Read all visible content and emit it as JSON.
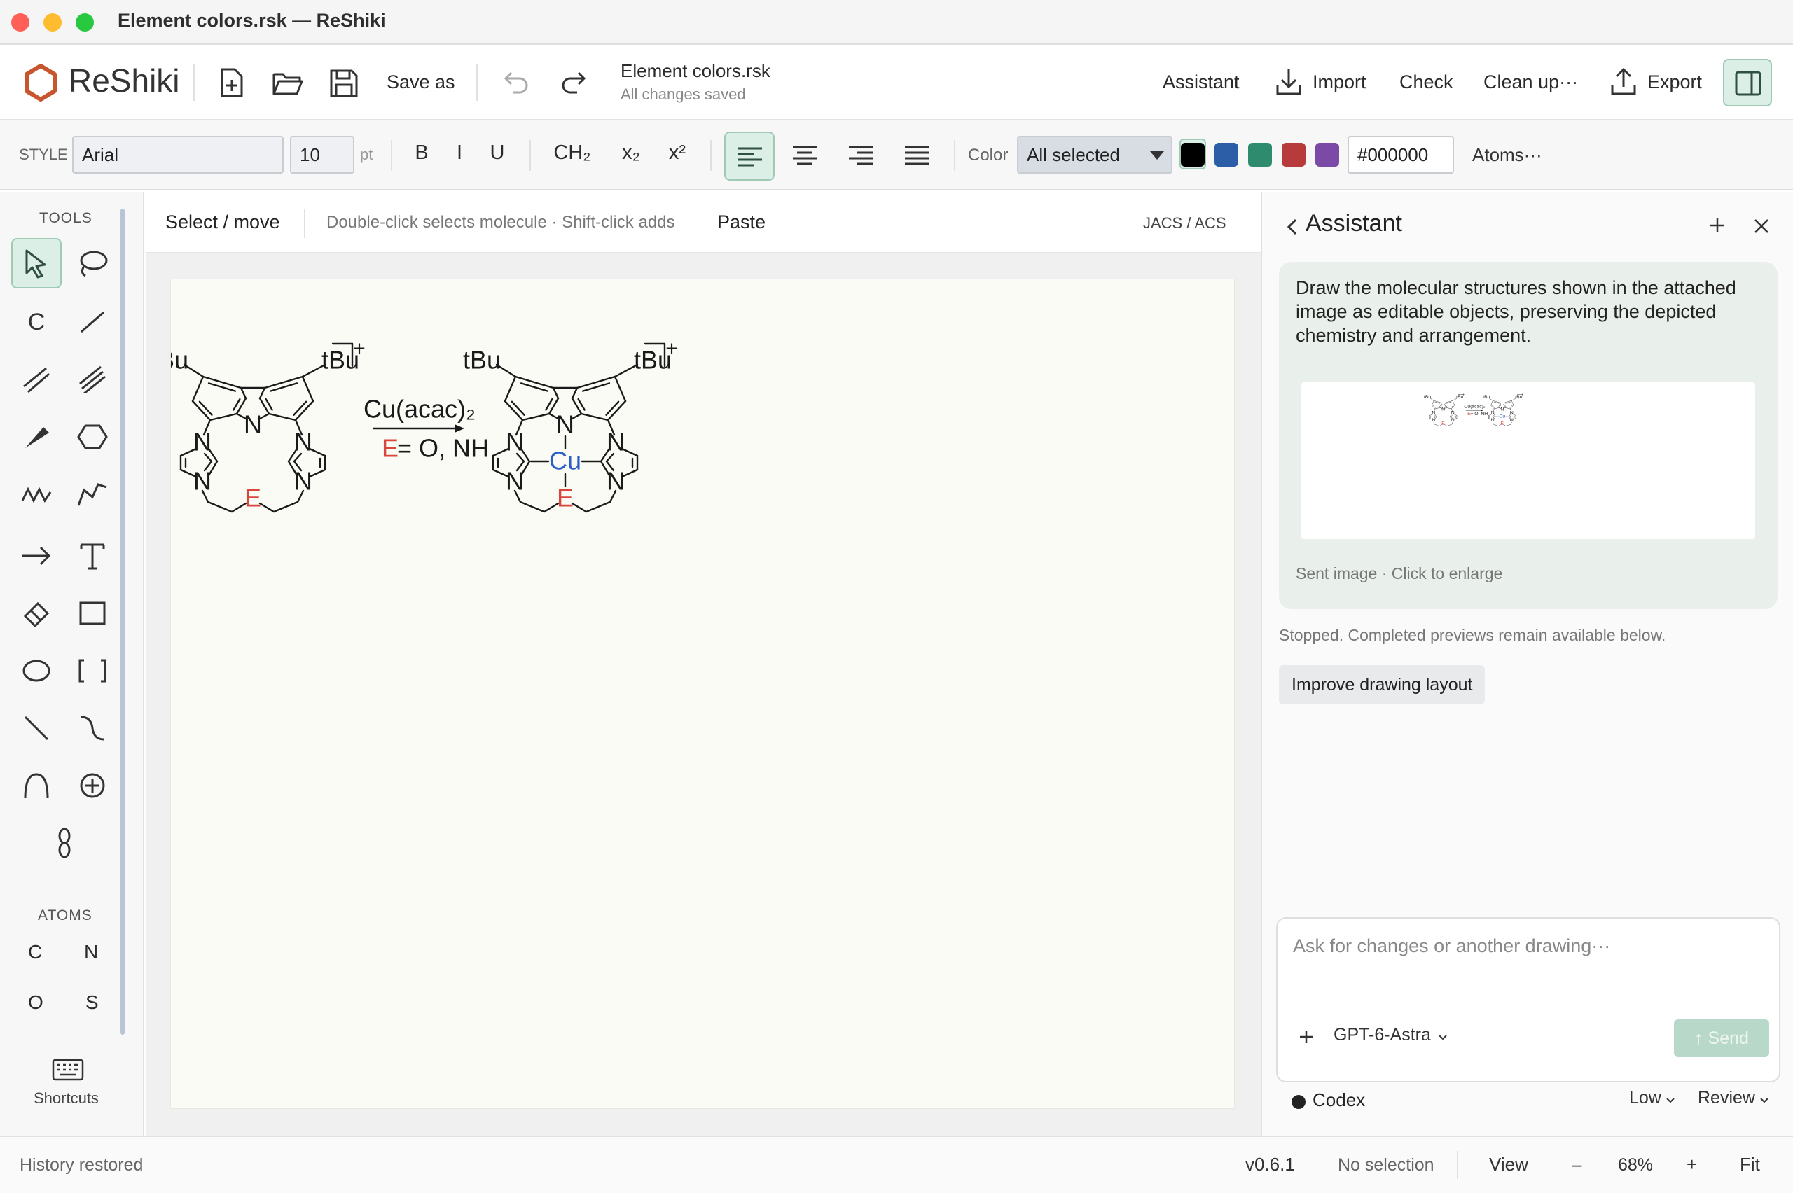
{
  "window": {
    "title": "Element colors.rsk — ReShiki"
  },
  "app": {
    "name": "ReShiki"
  },
  "toolbar": {
    "save_as": "Save as",
    "doc_name": "Element colors.rsk",
    "doc_status": "All changes saved",
    "assistant": "Assistant",
    "import": "Import",
    "check": "Check",
    "cleanup": "Clean up···",
    "export": "Export"
  },
  "style": {
    "label": "STYLE",
    "font": "Arial",
    "size": "10",
    "unit": "pt",
    "bold": "B",
    "italic": "I",
    "underline": "U",
    "ch2": "CH₂",
    "subscript": "x₂",
    "superscript": "x²",
    "color_label": "Color",
    "color_select": "All selected",
    "hex": "#000000",
    "atoms": "Atoms···",
    "swatches": [
      "#000000",
      "#2b5ea7",
      "#2e8b6e",
      "#b83b3b",
      "#7b4aa6"
    ]
  },
  "left": {
    "tools_caption": "TOOLS",
    "atoms_caption": "ATOMS",
    "atom_c": "C",
    "atom_n": "N",
    "atom_o": "O",
    "atom_s": "S",
    "chain_tool": "C",
    "shortcuts": "Shortcuts"
  },
  "mode": {
    "current": "Select / move",
    "hint": "Double-click selects molecule · Shift-click adds",
    "paste": "Paste",
    "style_preset": "JACS / ACS"
  },
  "scheme": {
    "tbu": "tBu",
    "charge": "+",
    "n": "N",
    "e": "E",
    "cu": "Cu",
    "reagent": "Cu(acac)₂",
    "condition_e": "E",
    "condition_rest": " = O, NH",
    "colors": {
      "hetero": "#d9473c",
      "metal": "#2b5ec9",
      "bond": "#1a1a1a"
    }
  },
  "assistant": {
    "title": "Assistant",
    "message": "Draw the molecular structures shown in the attached image as editable objects, preserving the depicted chemistry and arrangement.",
    "image_caption": "Sent image · Click to enlarge",
    "stopped": "Stopped. Completed previews remain available below.",
    "improve": "Improve drawing layout",
    "input_placeholder": "Ask for changes or another drawing···",
    "model": "GPT-6-Astra",
    "send": "Send",
    "agent": "Codex",
    "effort": "Low",
    "review": "Review"
  },
  "status": {
    "left": "History restored",
    "version": "v0.6.1",
    "selection": "No selection",
    "view": "View",
    "minus": "–",
    "zoom": "68%",
    "plus": "+",
    "fit": "Fit"
  }
}
